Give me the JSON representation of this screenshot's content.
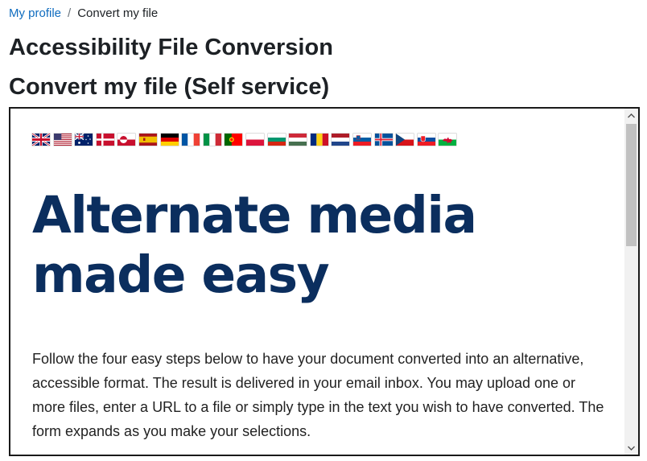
{
  "breadcrumb": {
    "items": [
      {
        "label": "My profile",
        "link": true
      },
      {
        "label": "Convert my file",
        "link": false
      }
    ],
    "separator": "/"
  },
  "page": {
    "title": "Accessibility File Conversion",
    "subtitle": "Convert my file (Self service)"
  },
  "embed": {
    "languages": [
      {
        "code": "en-gb",
        "icon": "flag-uk-icon"
      },
      {
        "code": "en-us",
        "icon": "flag-us-icon"
      },
      {
        "code": "en-au",
        "icon": "flag-australia-icon"
      },
      {
        "code": "da",
        "icon": "flag-denmark-icon"
      },
      {
        "code": "kl",
        "icon": "flag-greenland-icon"
      },
      {
        "code": "es",
        "icon": "flag-spain-icon"
      },
      {
        "code": "de",
        "icon": "flag-germany-icon"
      },
      {
        "code": "fr",
        "icon": "flag-france-icon"
      },
      {
        "code": "it",
        "icon": "flag-italy-icon"
      },
      {
        "code": "pt",
        "icon": "flag-portugal-icon"
      },
      {
        "code": "pl",
        "icon": "flag-poland-icon"
      },
      {
        "code": "bg",
        "icon": "flag-bulgaria-icon"
      },
      {
        "code": "hu",
        "icon": "flag-hungary-icon"
      },
      {
        "code": "ro",
        "icon": "flag-romania-icon"
      },
      {
        "code": "nl",
        "icon": "flag-netherlands-icon"
      },
      {
        "code": "sl",
        "icon": "flag-slovenia-icon"
      },
      {
        "code": "is",
        "icon": "flag-iceland-icon"
      },
      {
        "code": "cs",
        "icon": "flag-czech-icon"
      },
      {
        "code": "sk",
        "icon": "flag-slovakia-icon"
      },
      {
        "code": "cy",
        "icon": "flag-wales-icon"
      }
    ],
    "heading": "Alternate media made easy",
    "intro": "Follow the four easy steps below to have your document converted into an alternative, accessible format. The result is delivered in your email inbox. You may upload one or more files, enter a URL to a file or simply type in the text you wish to have converted. The form expands as you make your selections."
  },
  "colors": {
    "link": "#0f6cbf",
    "hero": "#0b2e5e",
    "frame_border": "#1a1a1a",
    "scroll_track": "#f1f1f1",
    "scroll_thumb": "#c1c1c1"
  }
}
